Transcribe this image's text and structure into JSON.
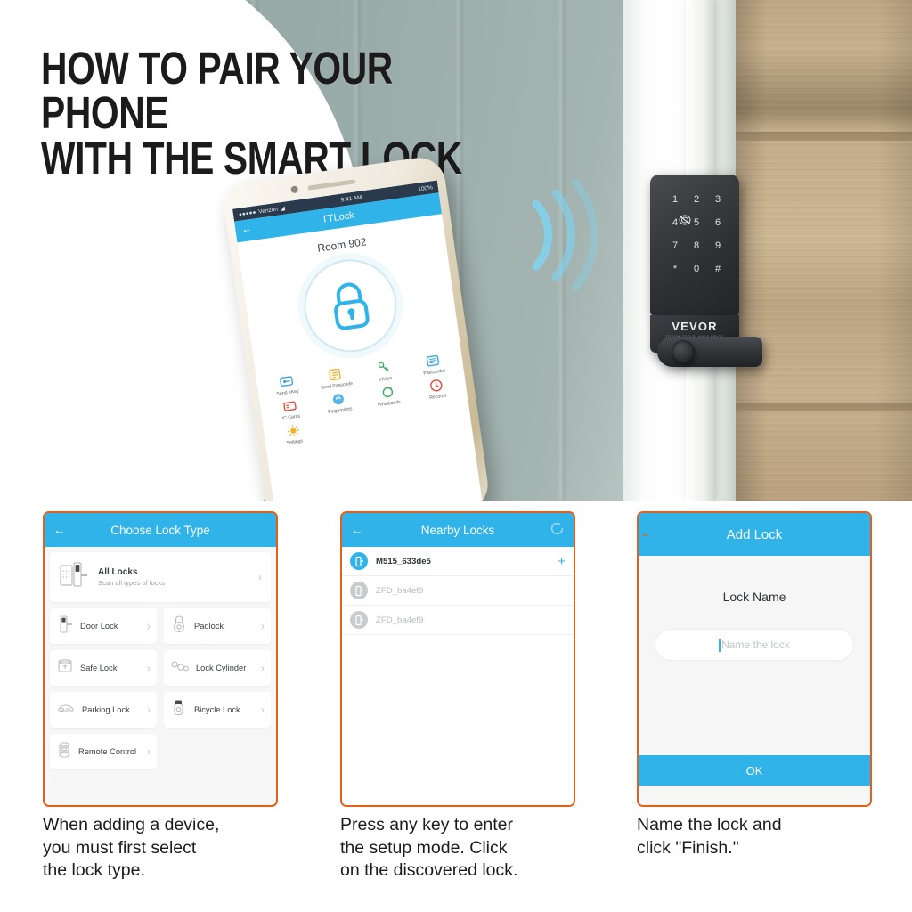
{
  "hero": {
    "title": "HOW TO PAIR YOUR PHONE\nWITH THE SMART LOCK",
    "lock_brand": "VEVOR",
    "lock_brand_tagline": "TOUGH TOOLS, HALF PRICE",
    "keypad_keys": [
      "1",
      "2",
      "3",
      "4",
      "5",
      "6",
      "7",
      "8",
      "9",
      "*",
      "0",
      "#"
    ]
  },
  "phone": {
    "status": {
      "carrier": "Verizon",
      "time": "9:41 AM",
      "battery": "100%"
    },
    "app_title": "TTLock",
    "room": "Room 902",
    "lock_state_icon": "padlock-icon",
    "apps": [
      {
        "label": "Send eKey",
        "icon": "send-ekey-icon",
        "color": "#3BA7E0"
      },
      {
        "label": "Send\nPasscode",
        "icon": "send-passcode-icon",
        "color": "#F0B429"
      },
      {
        "label": "eKeys",
        "icon": "ekeys-icon",
        "color": "#3FAE63"
      },
      {
        "label": "Passcodes",
        "icon": "passcodes-icon",
        "color": "#3BA7E0"
      },
      {
        "label": "IC Cards",
        "icon": "ic-cards-icon",
        "color": "#E24B3C"
      },
      {
        "label": "Fingerprints",
        "icon": "fingerprints-icon",
        "color": "#3BA7E0"
      },
      {
        "label": "Wristbands",
        "icon": "wristbands-icon",
        "color": "#3FAE63"
      },
      {
        "label": "Records",
        "icon": "records-icon",
        "color": "#E24B3C"
      },
      {
        "label": "Settings",
        "icon": "settings-icon",
        "color": "#F0B429"
      }
    ]
  },
  "colors": {
    "header_blue": "#2FB3E8",
    "border_orange": "#E2601B",
    "card_bg": "#F6F6F6"
  },
  "card1": {
    "title": "Choose Lock Type",
    "back_icon": "back-arrow-icon",
    "all_locks": {
      "title": "All Locks",
      "subtitle": "Scan all types of locks",
      "icon": "smart-door-lock-icon",
      "chevron": "›"
    },
    "items": [
      {
        "label": "Door Lock",
        "icon": "door-lock-icon"
      },
      {
        "label": "Padlock",
        "icon": "padlock-icon"
      },
      {
        "label": "Safe Lock",
        "icon": "safe-lock-icon"
      },
      {
        "label": "Lock Cylinder",
        "icon": "lock-cylinder-icon"
      },
      {
        "label": "Parking Lock",
        "icon": "parking-lock-icon"
      },
      {
        "label": "Bicycle Lock",
        "icon": "bicycle-lock-icon"
      },
      {
        "label": "Remote\nControl",
        "icon": "remote-control-icon"
      }
    ],
    "chevron": "›",
    "caption": "When adding a device,\nyou must first select\nthe lock type."
  },
  "card2": {
    "title": "Nearby Locks",
    "back_icon": "back-arrow-icon",
    "refresh_icon": "loading-spinner-icon",
    "rows": [
      {
        "name": "M515_633de5",
        "state": "on",
        "action": "+"
      },
      {
        "name": "ZFD_ba4ef9",
        "state": "off",
        "action": ""
      },
      {
        "name": "ZFD_ba4ef9",
        "state": "off",
        "action": ""
      }
    ],
    "caption": "Press any key to enter\nthe setup mode. Click\non the discovered lock."
  },
  "card3": {
    "title": "Add Lock",
    "back_icon": "back-arrow-icon",
    "field_label": "Lock Name",
    "input_value": "",
    "input_placeholder": "Name the lock",
    "ok_label": "OK",
    "caption": "Name the lock and\nclick \"Finish.\""
  }
}
